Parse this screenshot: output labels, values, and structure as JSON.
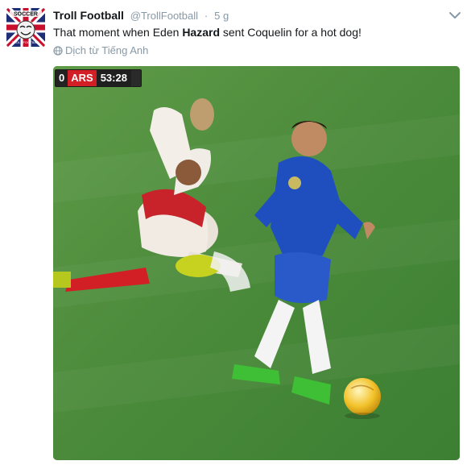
{
  "tweet": {
    "author_name": "Troll Football",
    "author_handle": "@TrollFootball",
    "separator": "·",
    "time": "5 g",
    "text_before": "That moment when Eden ",
    "text_bold": "Hazard",
    "text_after": " sent Coquelin for a hot dog!",
    "translate_label": "Dịch từ Tiếng Anh",
    "avatar_text_top": "SOCCER",
    "avatar_text_bottom": "TROLL FOOTBALL"
  },
  "media": {
    "scorebug": {
      "home_score": "0",
      "team": "ARS",
      "clock": "53:28"
    }
  },
  "icons": {
    "caret": "chevron-down-icon",
    "globe": "globe-icon"
  },
  "colors": {
    "text": "#14171a",
    "muted": "#8899a6",
    "pitch": "#3f8f36",
    "arsenal_red": "#d21f26",
    "chelsea_blue": "#1f4fbf"
  }
}
